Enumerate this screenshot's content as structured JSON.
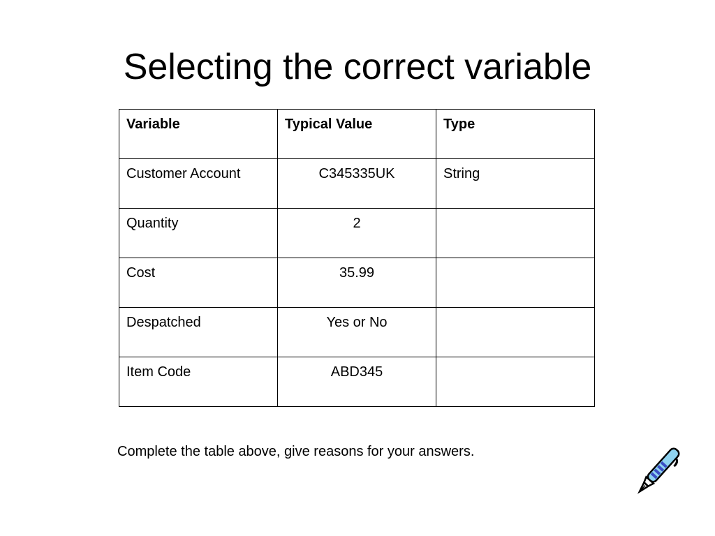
{
  "slide": {
    "title": "Selecting the correct variable",
    "instruction": "Complete the table above, give reasons for your answers."
  },
  "table": {
    "headers": [
      "Variable",
      "Typical Value",
      "Type"
    ],
    "rows": [
      {
        "variable": "Customer Account",
        "typical_value": "C345335UK",
        "type": "String"
      },
      {
        "variable": "Quantity",
        "typical_value": "2",
        "type": ""
      },
      {
        "variable": "Cost",
        "typical_value": "35.99",
        "type": ""
      },
      {
        "variable": "Despatched",
        "typical_value": "Yes or No",
        "type": ""
      },
      {
        "variable": "Item Code",
        "typical_value": "ABD345",
        "type": ""
      }
    ]
  },
  "icons": {
    "pen": "pen-icon"
  },
  "colors": {
    "pen_body": "#8fd3f0",
    "pen_accent": "#3b4fc4",
    "outline": "#000000"
  }
}
